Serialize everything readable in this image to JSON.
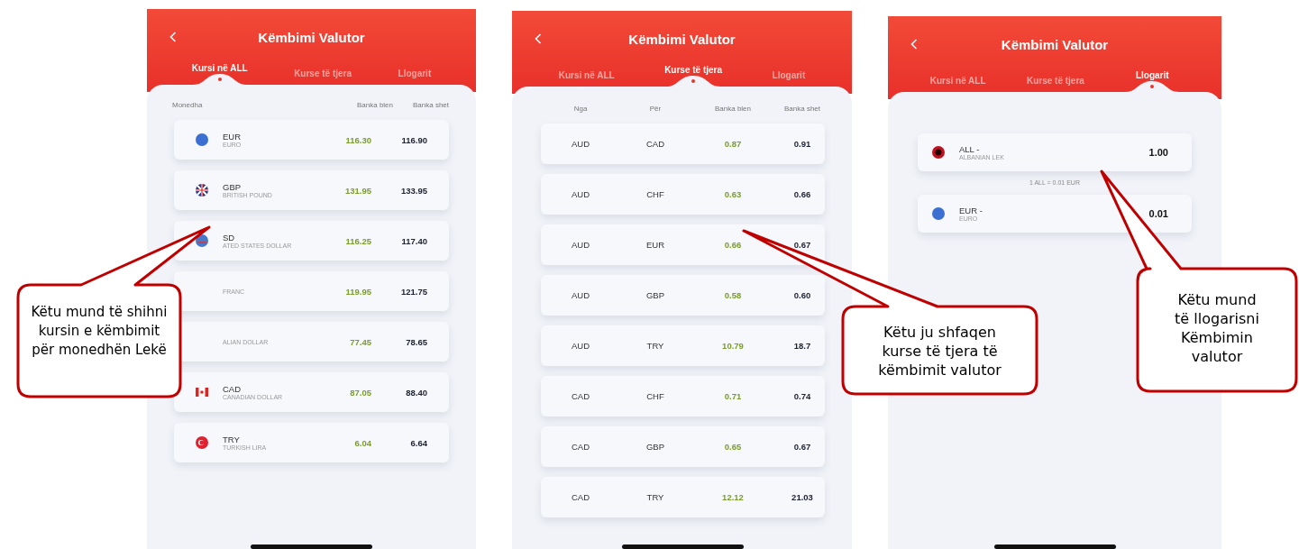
{
  "screens": [
    {
      "kind": "rates",
      "title": "Këmbimi Valutor",
      "tabs": [
        {
          "label": "Kursi në ALL",
          "selected": true
        },
        {
          "label": "Kurse të tjera",
          "selected": false
        },
        {
          "label": "Llogarit",
          "selected": false
        }
      ],
      "columns": [
        "Monedha",
        "Banka blen",
        "Banka shet"
      ],
      "rows": [
        {
          "kind": "eu",
          "code": "EUR",
          "name": "EURO",
          "buy": "116.30",
          "sell": "116.90"
        },
        {
          "kind": "gb",
          "code": "GBP",
          "name": "BRITISH POUND",
          "buy": "131.95",
          "sell": "133.95"
        },
        {
          "kind": "us",
          "code": "SD",
          "name": "ATED STATES DOLLAR",
          "buy": "116.25",
          "sell": "117.40"
        },
        {
          "kind": "hidden",
          "name": "FRANC",
          "buy": "119.95",
          "sell": "121.75"
        },
        {
          "kind": "hidden",
          "name": "ALIAN DOLLAR",
          "buy": "77.45",
          "sell": "78.65"
        },
        {
          "kind": "ca",
          "code": "CAD",
          "name": "CANADIAN DOLLAR",
          "buy": "87.05",
          "sell": "88.40"
        },
        {
          "kind": "tr",
          "code": "TRY",
          "name": "TURKISH LIRA",
          "buy": "6.04",
          "sell": "6.64"
        }
      ]
    },
    {
      "kind": "pairs",
      "title": "Këmbimi Valutor",
      "tabs": [
        {
          "label": "Kursi në ALL",
          "selected": false
        },
        {
          "label": "Kurse të tjera",
          "selected": true
        },
        {
          "label": "Llogarit",
          "selected": false
        }
      ],
      "columns": [
        "Nga",
        "Për",
        "Banka blen",
        "Banka shet"
      ],
      "rows": [
        {
          "from": "AUD",
          "to": "CAD",
          "buy": "0.87",
          "sell": "0.91"
        },
        {
          "from": "AUD",
          "to": "CHF",
          "buy": "0.63",
          "sell": "0.66"
        },
        {
          "from": "AUD",
          "to": "EUR",
          "buy": "0.66",
          "sell": "0.67"
        },
        {
          "from": "AUD",
          "to": "GBP",
          "buy": "0.58",
          "sell": "0.60"
        },
        {
          "from": "AUD",
          "to": "TRY",
          "buy": "10.79",
          "sell": "18.7"
        },
        {
          "from": "CAD",
          "to": "CHF",
          "buy": "0.71",
          "sell": "0.74"
        },
        {
          "from": "CAD",
          "to": "GBP",
          "buy": "0.65",
          "sell": "0.67"
        },
        {
          "from": "CAD",
          "to": "TRY",
          "buy": "12.12",
          "sell": "21.03"
        }
      ]
    },
    {
      "kind": "calculator",
      "title": "Këmbimi Valutor",
      "tabs": [
        {
          "label": "Kursi në ALL",
          "selected": false
        },
        {
          "label": "Kurse të tjera",
          "selected": false
        },
        {
          "label": "Llogarit",
          "selected": true
        }
      ],
      "accounts": [
        {
          "kind": "al",
          "code": "ALL -",
          "name": "ALBANIAN LEK",
          "amount": "1.00"
        },
        {
          "kind": "eu",
          "code": "EUR -",
          "name": "EURO",
          "amount": "0.01"
        }
      ],
      "rate": "1 ALL = 0.01 EUR"
    }
  ],
  "callouts": [
    "Këtu mund të shihni kursin e këmbimit për monedhën Lekë",
    "Këtu ju shfaqen\nkurse të tjera të\nkëmbimit valutor",
    "Këtu mund\ntë llogarisni\nKëmbimin\nvalutor"
  ]
}
